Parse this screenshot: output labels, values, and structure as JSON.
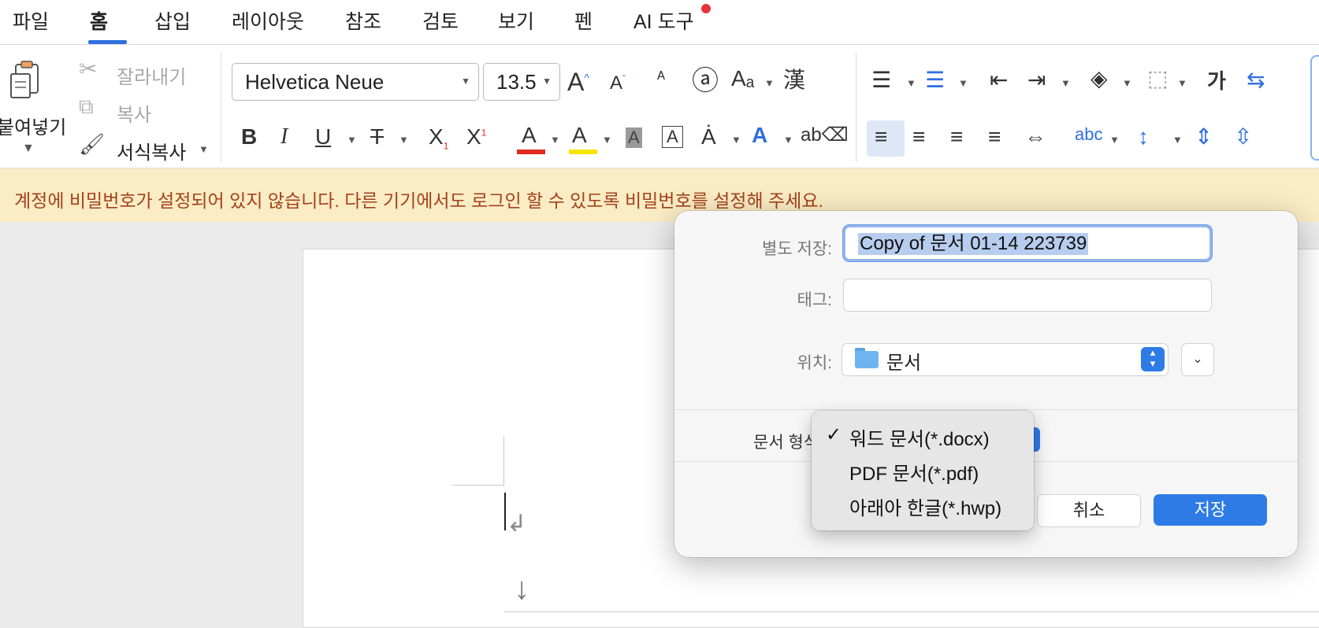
{
  "menu": {
    "items": [
      "파일",
      "홈",
      "삽입",
      "레이아웃",
      "참조",
      "검토",
      "보기",
      "펜",
      "AI 도구"
    ],
    "active": "홈"
  },
  "ribbon": {
    "paste_label": "붙여넣기",
    "cut_label": "잘라내기",
    "copy_label": "복사",
    "format_painter_label": "서식복사",
    "font_name": "Helvetica Neue",
    "font_size": "13.5",
    "hanja_label": "漢",
    "spacing_label": "가"
  },
  "banner": {
    "text": "계정에 비밀번호가 설정되어 있지 않습니다. 다른 기기에서도 로그인 할 수 있도록 비밀번호를 설정해 주세요."
  },
  "dialog": {
    "save_as_label": "별도 저장:",
    "filename": "Copy of 문서 01-14 223739",
    "tags_label": "태그:",
    "location_label": "위치:",
    "location_value": "문서",
    "format_label": "문서 형식",
    "cancel": "취소",
    "save": "저장"
  },
  "format_options": [
    {
      "label": "워드 문서(*.docx)",
      "selected": true
    },
    {
      "label": "PDF 문서(*.pdf)",
      "selected": false
    },
    {
      "label": "아래아 한글(*.hwp)",
      "selected": false
    }
  ],
  "colors": {
    "accent": "#2f7be6",
    "banner_bg": "#faecc4",
    "banner_text": "#a3421c",
    "font_color_underline": "#e02b20",
    "highlight_underline": "#f5e400"
  }
}
